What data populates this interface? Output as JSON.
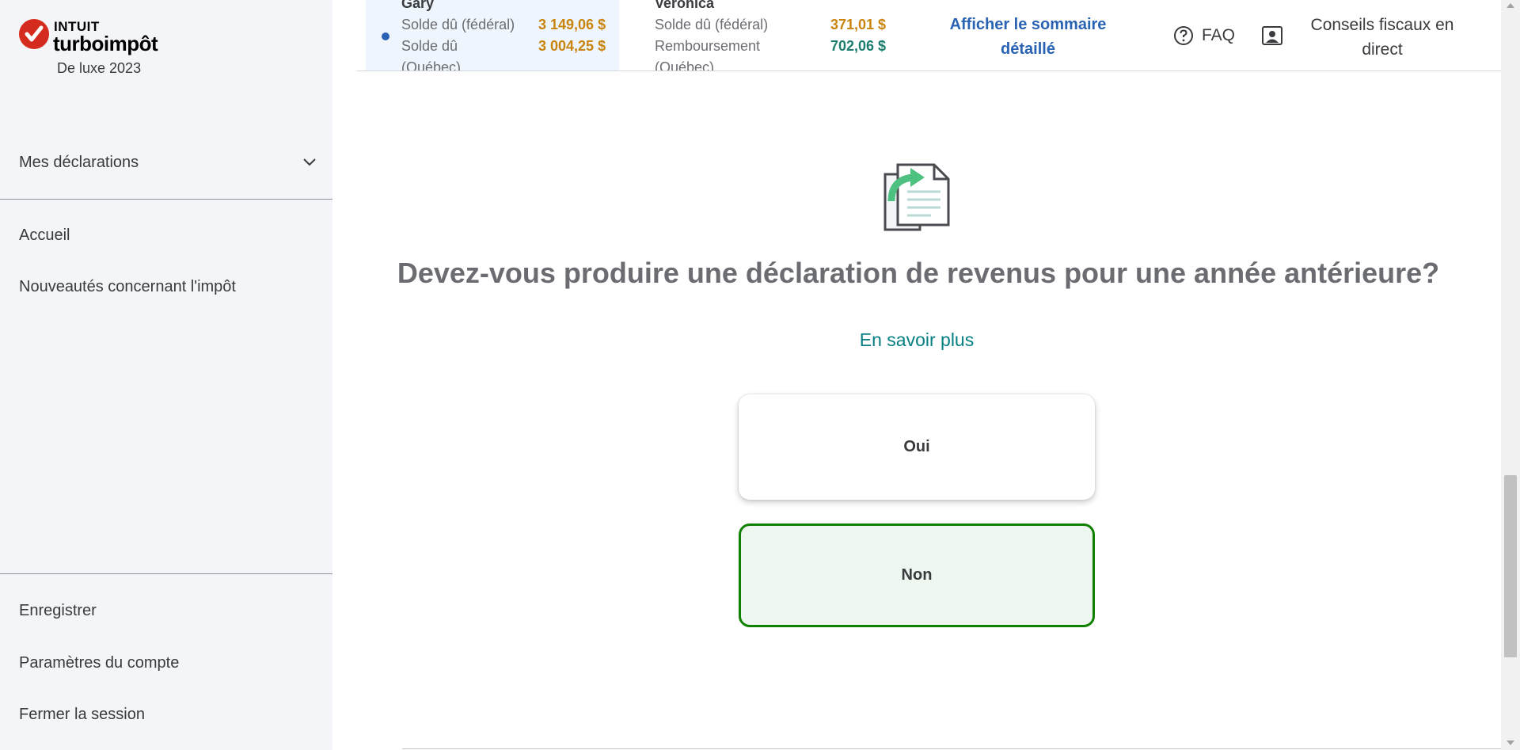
{
  "brand": {
    "company": "INTUIT",
    "product": "turboimpôt",
    "edition": "De luxe 2023",
    "accent_color": "#d52b1e"
  },
  "sidebar": {
    "returns_label": "Mes déclarations",
    "nav": [
      {
        "label": "Accueil"
      },
      {
        "label": "Nouveautés concernant l'impôt"
      }
    ],
    "footer": [
      {
        "label": "Enregistrer"
      },
      {
        "label": "Paramètres du compte"
      },
      {
        "label": "Fermer la session"
      }
    ]
  },
  "header": {
    "taxpayers": [
      {
        "name": "Gary",
        "rows": [
          {
            "label": "Solde dû (fédéral)",
            "value": "3 149,06 $",
            "status": "owing"
          },
          {
            "label": "Solde dû (Québec)",
            "value": "3 004,25 $",
            "status": "owing"
          }
        ]
      },
      {
        "name": "Veronica",
        "rows": [
          {
            "label": "Solde dû (fédéral)",
            "value": "371,01 $",
            "status": "owing"
          },
          {
            "label": "Remboursement (Québec)",
            "value": "702,06 $",
            "status": "refund"
          }
        ]
      }
    ],
    "summary_link": "Afficher le sommaire détaillé",
    "faq_label": "FAQ",
    "expert_label": "Conseils fiscaux en direct"
  },
  "main": {
    "question": "Devez-vous produire une déclaration de revenus pour une année antérieure?",
    "learn_more": "En savoir plus",
    "yes_label": "Oui",
    "no_label": "Non",
    "selected_color": "#108000",
    "link_color": "#057f83"
  },
  "icons": [
    "checkmark-logo-icon",
    "chevron-down-icon",
    "question-circle-icon",
    "expert-portrait-icon",
    "document-copy-icon"
  ]
}
